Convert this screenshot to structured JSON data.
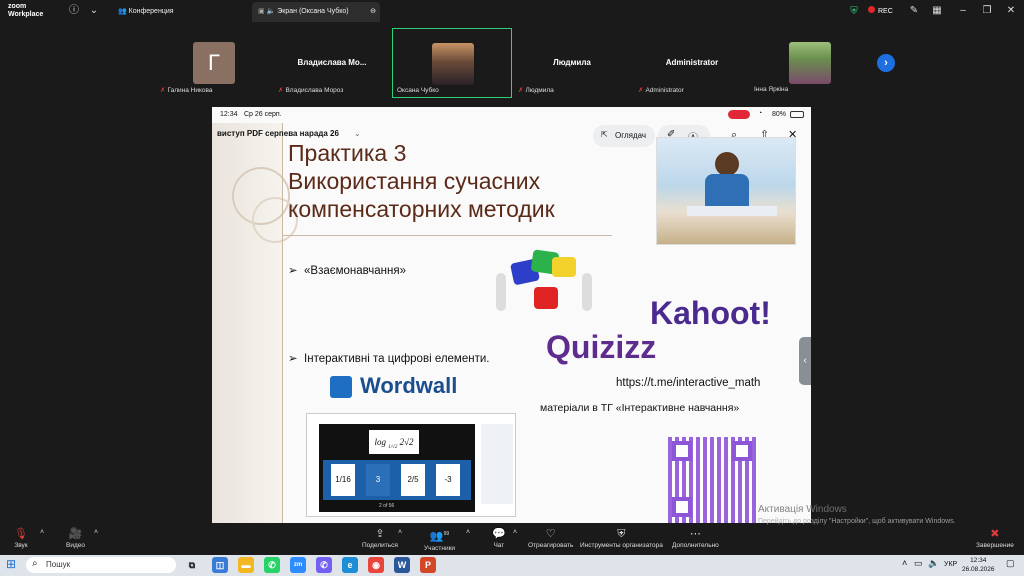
{
  "app": {
    "logo_line1": "zoom",
    "logo_line2": "Workplace"
  },
  "tabs": [
    {
      "label": "Конференция"
    },
    {
      "label": "Экран (Оксана Чубко)"
    }
  ],
  "topbar": {
    "rec_label": "REC"
  },
  "participants": [
    {
      "name": "Галина Никова",
      "avatar_letter": "Г"
    },
    {
      "name": "Владислава Мороз",
      "display": "Владислава  Мо..."
    },
    {
      "name": "Оксана Чубко"
    },
    {
      "name": "Людмила",
      "display": "Людмила"
    },
    {
      "name": "Administrator",
      "display": "Administrator"
    },
    {
      "name": "Інна Яркіна"
    }
  ],
  "screen": {
    "time": "12:34",
    "date": "Ср 26 серп.",
    "battery": "80%",
    "doc_title": "виступ  PDF серпева нарада 26",
    "view_button": "Оглядач",
    "slide": {
      "title_line1": "Практика 3",
      "title_line2": "Використання сучасних",
      "title_line3": "компенсаторних методик",
      "bullet1": "«Взаємонавчання»",
      "bullet2": "Інтерактивні та цифрові елементи.",
      "wordwall": "Wordwall",
      "kahoot": "Kahoot!",
      "quizizz": "Quizizz",
      "link": "https://t.me/interactive_math",
      "tg_note": "матеріали в ТГ «Інтерактивне навчання»",
      "ww_expr": "log",
      "ww_expr_base": "1/√2",
      "ww_expr_arg": "2√2",
      "ww_answers": [
        "1/16",
        "3",
        "2/5",
        "-3"
      ],
      "ww_pager": "2 of 56"
    }
  },
  "watermark": {
    "line1": "Активація Windows",
    "line2": "Перейдіть до розділу \"Настройки\", щоб активувати Windows."
  },
  "bottombar": {
    "audio": "Звук",
    "video": "Видео",
    "share": "Поделиться",
    "participants": "Участники",
    "participants_count": "99",
    "chat": "Чат",
    "react": "Отреагировать",
    "host_tools": "Инструменты организатора",
    "more": "Дополнительно",
    "end": "Завершение"
  },
  "taskbar": {
    "search": "Пошук",
    "lang": "УКР",
    "clock_time": "12:34",
    "clock_date": "26.08.2026"
  }
}
